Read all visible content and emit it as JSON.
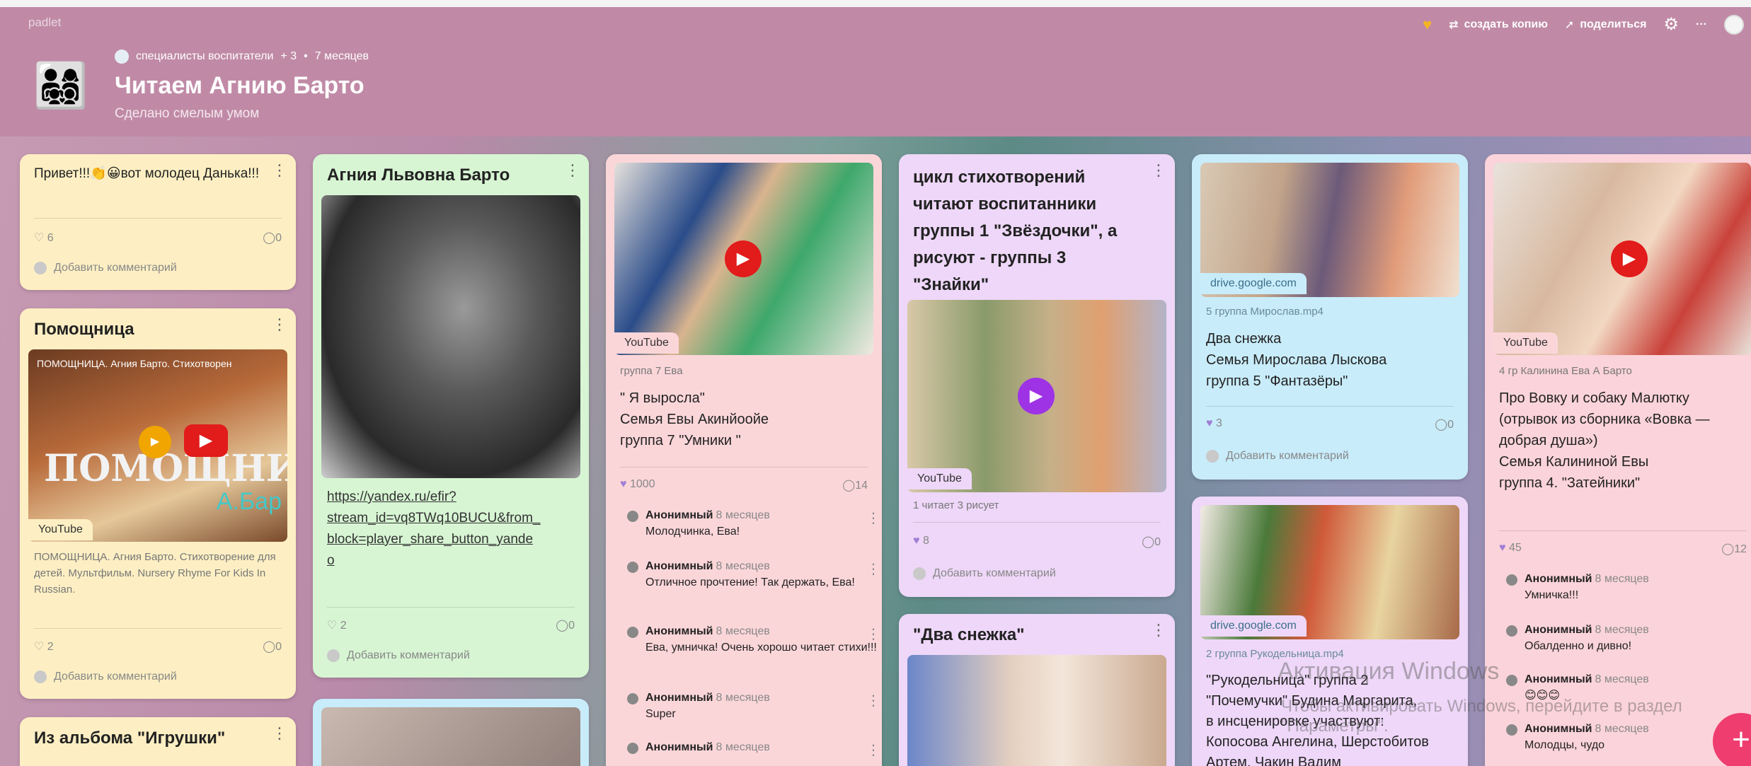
{
  "header": {
    "brand": "padlet",
    "actions": {
      "remake": "создать копию",
      "share": "поделиться"
    },
    "meta": {
      "author": "специалисты воспитатели",
      "plus": "+ 3",
      "time": "7 месяцев"
    },
    "title": "Читаем Агнию Барто",
    "subtitle": "Сделано смелым умом"
  },
  "col1": {
    "card1": {
      "text": "Привет!!!👏😀вот молодец Данька!!!",
      "likes": "6",
      "comments": "0",
      "add": "Добавить комментарий"
    },
    "card2": {
      "title": "Помощница",
      "thumb_caption": "ПОМОЩНИЦА. Агния Барто. Стихотворен",
      "thumb_big": "ПОМОЩНИЦ",
      "thumb_sub": "А.Бар",
      "badge": "YouTube",
      "desc": "ПОМОЩНИЦА. Агния Барто. Стихотворение для детей. Мультфильм. Nursery Rhyme For Kids In Russian.",
      "likes": "2",
      "comments": "0",
      "add": "Добавить комментарий"
    },
    "card3": {
      "title": "Из альбома \"Игрушки\""
    }
  },
  "col2": {
    "card1": {
      "title": "Агния Львовна Барто",
      "link": "https://yandex.ru/efir?stream_id=vq8TWq10BUCU&from_block=player_share_button_yandex",
      "link_l1": "https://yandex.ru/efir?",
      "link_l2": "stream_id=vq8TWq10BUCU&from_",
      "link_l3": "block=player_share_button_yande",
      "link_l4": "o",
      "likes": "2",
      "comments": "0",
      "add": "Добавить комментарий"
    }
  },
  "col3": {
    "card1": {
      "badge": "YouTube",
      "group": "группа 7 Ева",
      "line1": "\" Я выросла\"",
      "line2": "Семья Евы Акинйоойе",
      "line3": " группа 7 \"Умники \"",
      "likes": "1000",
      "comments": "14",
      "comments_list": [
        {
          "who": "Анонимный",
          "when": "8 месяцев",
          "text": "Молодчинка, Ева!"
        },
        {
          "who": "Анонимный",
          "when": "8 месяцев",
          "text": "Отличное прочтение! Так держать, Ева!"
        },
        {
          "who": "Анонимный",
          "when": "8 месяцев",
          "text": "Ева, умничка! Очень хорошо читает стихи!!!"
        },
        {
          "who": "Анонимный",
          "when": "8 месяцев",
          "text": "Super"
        },
        {
          "who": "Анонимный",
          "when": "8 месяцев",
          "text": ""
        }
      ]
    }
  },
  "col4": {
    "card1": {
      "title_l1": "цикл стихотворений",
      "title_l2": "читают воспитанники",
      "title_l3": "группы 1 \"Звёздочки\", а",
      "title_l4": "рисуют - группы 3",
      "title_l5": "\"Знайки\"",
      "badge": "YouTube",
      "caption": "1 читает 3 рисует",
      "likes": "8",
      "comments": "0",
      "add": "Добавить комментарий"
    },
    "card2": {
      "title": "\"Два снежка\""
    }
  },
  "col5": {
    "card1": {
      "badge": "drive.google.com",
      "file": "5 группа Мирослав.mp4",
      "line1": "Два снежка",
      "line2": "Семья Мирослава Лыскова",
      "line3": "группа 5 \"Фантазёры\"",
      "likes": "3",
      "comments": "0",
      "add": "Добавить комментарий"
    },
    "card2": {
      "badge": "drive.google.com",
      "file": "2 группа Рукодельница.mp4",
      "line1": "\"Рукодельница\" группа 2",
      "line2": "\"Почемучки\" Будина Маргарита,",
      "line3": "в инсценировке участвуют:",
      "line4": "Копосова Ангелина, Шерстобитов",
      "line5": "Артем, Чакин Вадим"
    }
  },
  "col6": {
    "card1": {
      "badge": "YouTube",
      "group": "4 гр Калинина Ева А Барто",
      "line1": "Про Вовку и собаку Малютку",
      "line2": "(отрывок из сборника «Вовка —",
      "line3": "добрая душа»)",
      "line4": "Семья Калининой Евы",
      "line5": "группа 4. \"Затейники\"",
      "likes": "45",
      "comments": "12",
      "comments_list": [
        {
          "who": "Анонимный",
          "when": "8 месяцев",
          "text": "Умничка!!!"
        },
        {
          "who": "Анонимный",
          "when": "8 месяцев",
          "text": "Обалденно и дивно!"
        },
        {
          "who": "Анонимный",
          "when": "8 месяцев",
          "text": "😊😊😊"
        },
        {
          "who": "Анонимный",
          "when": "8 месяцев",
          "text": "Молодцы, чудо"
        }
      ]
    }
  },
  "overlay": {
    "watermark1": "Активация Windows",
    "watermark2": "Чтобы активировать Windows, перейдите в раздел \"Параметры\".",
    "fab": "+"
  }
}
